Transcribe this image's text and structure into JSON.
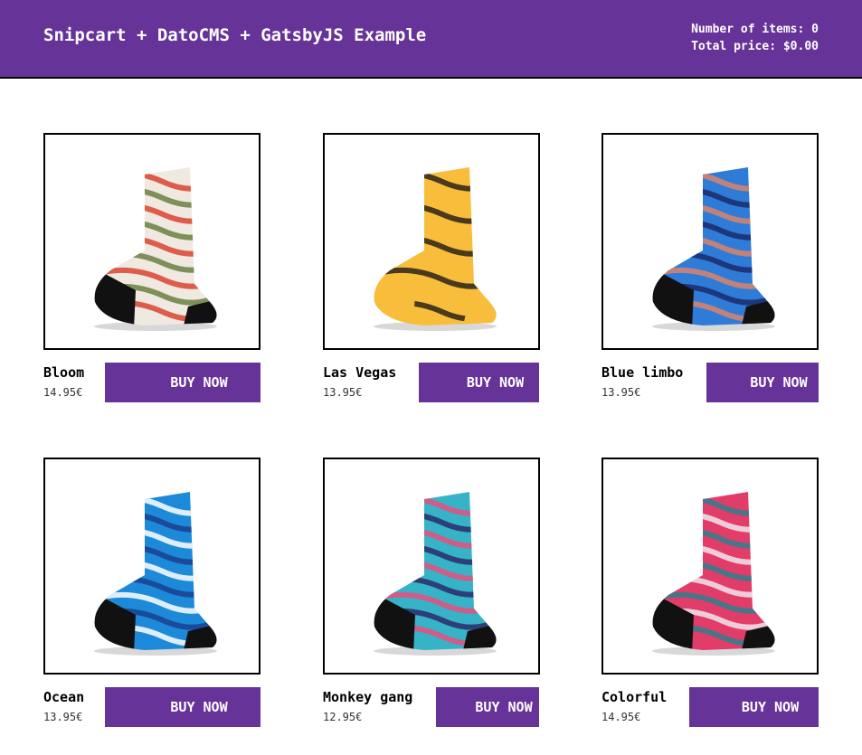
{
  "header": {
    "title": "Snipcart + DatoCMS + GatsbyJS Example",
    "items_label": "Number of items: 0",
    "total_label": "Total price: $0.00"
  },
  "buy_label": "BUY NOW",
  "products": [
    {
      "name": "Bloom",
      "price": "14.95€",
      "icon": "sock-floral-image",
      "colors": {
        "base": "#efe9e1",
        "pattern": "#d9442f",
        "accent": "#6b7f3f",
        "heel": "#111111"
      }
    },
    {
      "name": "Las Vegas",
      "price": "13.95€",
      "icon": "sock-yellow-doodle-image",
      "colors": {
        "base": "#f9bd3c",
        "pattern": "#2b2316",
        "accent": "#f9bd3c",
        "heel": "#f9bd3c"
      }
    },
    {
      "name": "Blue limbo",
      "price": "13.95€",
      "icon": "sock-blue-pattern-image",
      "colors": {
        "base": "#2f7bd8",
        "pattern": "#d9846b",
        "accent": "#1b2a6a",
        "heel": "#111111"
      }
    },
    {
      "name": "Ocean",
      "price": "13.95€",
      "icon": "sock-ocean-wave-image",
      "colors": {
        "base": "#1c8ad8",
        "pattern": "#ffffff",
        "accent": "#1a3f8f",
        "heel": "#111111"
      }
    },
    {
      "name": "Monkey gang",
      "price": "12.95€",
      "icon": "sock-monkey-image",
      "colors": {
        "base": "#36b3c7",
        "pattern": "#e84f7d",
        "accent": "#2a2a6a",
        "heel": "#111111"
      }
    },
    {
      "name": "Colorful",
      "price": "14.95€",
      "icon": "sock-colorful-stripe-image",
      "colors": {
        "base": "#e23c69",
        "pattern": "#2f7f8f",
        "accent": "#f0e6ee",
        "heel": "#111111"
      }
    }
  ]
}
